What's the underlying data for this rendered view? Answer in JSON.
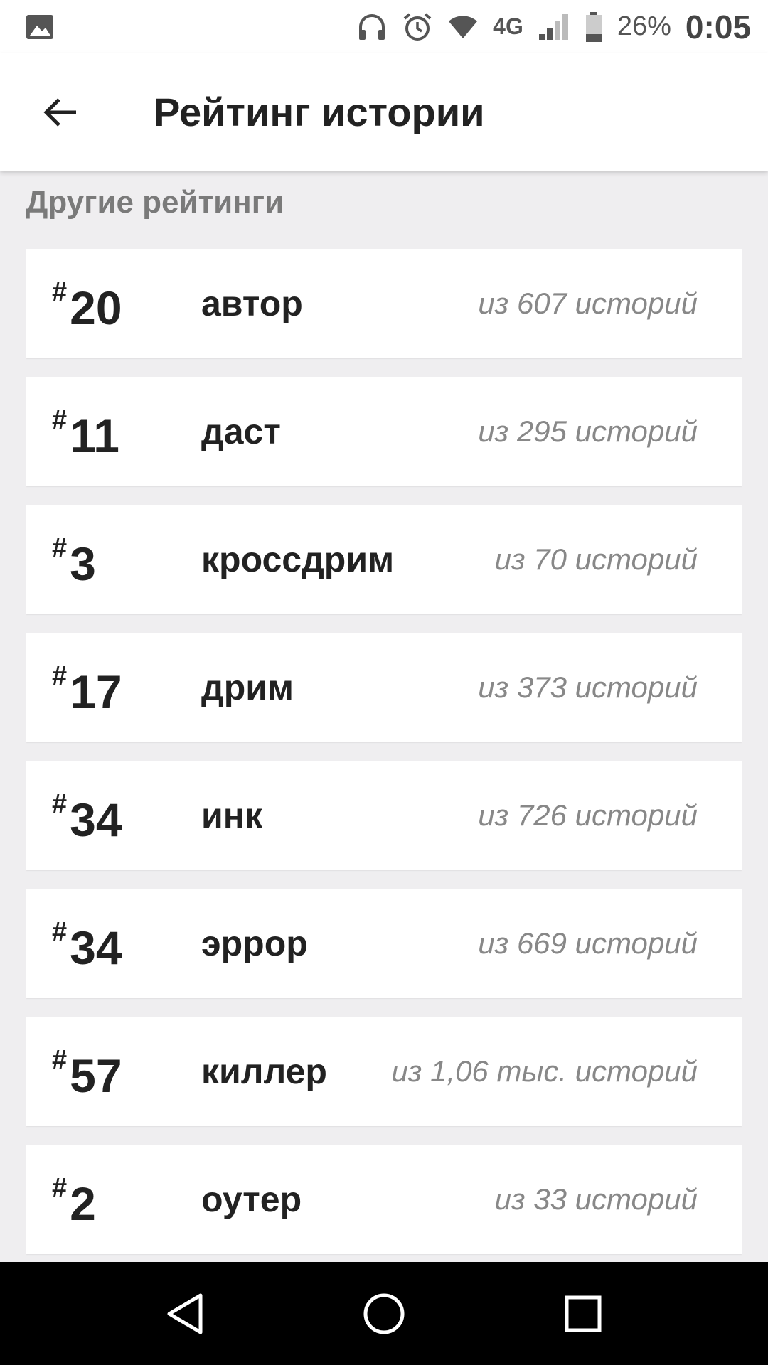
{
  "status_bar": {
    "battery_percent": "26%",
    "time": "0:05",
    "network": "4G",
    "icons": [
      "image-icon",
      "headphones-icon",
      "alarm-icon",
      "wifi-icon",
      "signal-icon",
      "battery-icon"
    ]
  },
  "app_bar": {
    "title": "Рейтинг истории",
    "back_icon": "arrow-back-icon"
  },
  "section": {
    "title": "Другие рейтинги"
  },
  "rankings": [
    {
      "hash": "#",
      "rank": "20",
      "tag": "автор",
      "total": "из 607 историй"
    },
    {
      "hash": "#",
      "rank": "11",
      "tag": "даст",
      "total": "из 295 историй"
    },
    {
      "hash": "#",
      "rank": "3",
      "tag": "кроссдрим",
      "total": "из 70 историй"
    },
    {
      "hash": "#",
      "rank": "17",
      "tag": "дрим",
      "total": "из 373 историй"
    },
    {
      "hash": "#",
      "rank": "34",
      "tag": "инк",
      "total": "из 726 историй"
    },
    {
      "hash": "#",
      "rank": "34",
      "tag": "эррор",
      "total": "из 669 историй"
    },
    {
      "hash": "#",
      "rank": "57",
      "tag": "киллер",
      "total": "из 1,06 тыс. историй"
    },
    {
      "hash": "#",
      "rank": "2",
      "tag": "оутер",
      "total": "из 33 историй"
    }
  ],
  "nav_bar": {
    "icons": [
      "back-triangle-icon",
      "home-circle-icon",
      "recents-square-icon"
    ]
  },
  "colors": {
    "background": "#efeef0",
    "card": "#ffffff",
    "text_primary": "#222222",
    "text_secondary": "#888888",
    "section_title": "#7a7a7a"
  }
}
